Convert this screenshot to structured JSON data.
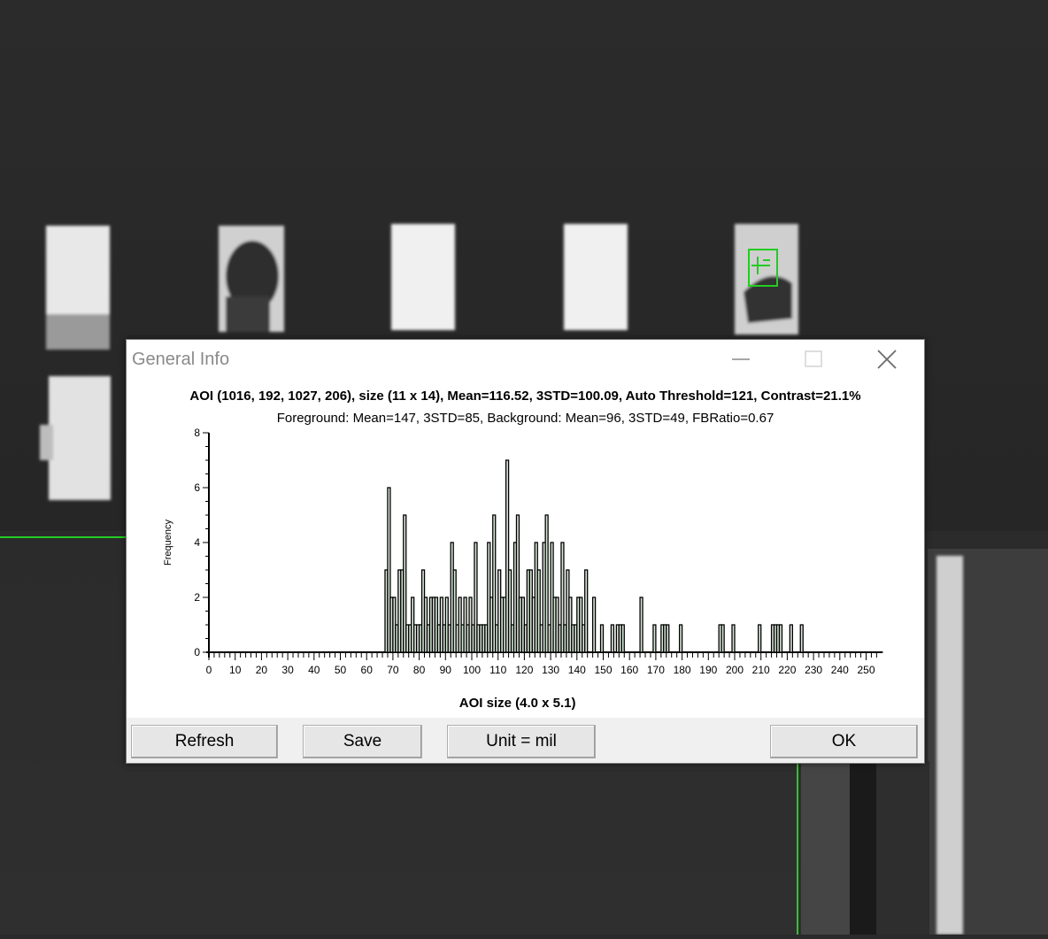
{
  "window": {
    "title": "General Info"
  },
  "info": {
    "line1": "AOI (1016, 192, 1027, 206), size (11 x 14), Mean=116.52, 3STD=100.09, Auto Threshold=121, Contrast=21.1%",
    "line2": "Foreground: Mean=147, 3STD=85, Background: Mean=96, 3STD=49, FBRatio=0.67"
  },
  "buttons": {
    "refresh": "Refresh",
    "save": "Save",
    "unit": "Unit = mil",
    "ok": "OK"
  },
  "colors": {
    "overlay_green": "#22cc22",
    "bar_fill": "#d8e6d8",
    "bar_stroke": "#000000"
  },
  "icons": {
    "minimize": "minimize-icon",
    "maximize": "maximize-icon",
    "close": "close-icon"
  },
  "chart_data": {
    "type": "bar",
    "title": "",
    "xlabel": "AOI size (4.0 x 5.1)",
    "ylabel": "Frequency",
    "xlim": [
      0,
      255
    ],
    "ylim": [
      0,
      8
    ],
    "xticks": [
      0,
      10,
      20,
      30,
      40,
      50,
      60,
      70,
      80,
      90,
      100,
      110,
      120,
      130,
      140,
      150,
      160,
      170,
      180,
      190,
      200,
      210,
      220,
      230,
      240,
      250
    ],
    "yticks": [
      0,
      2,
      4,
      6,
      8
    ],
    "x": [
      67,
      68,
      69,
      70,
      71,
      72,
      73,
      74,
      75,
      76,
      77,
      78,
      79,
      80,
      81,
      82,
      83,
      84,
      85,
      86,
      87,
      88,
      89,
      90,
      91,
      92,
      93,
      94,
      95,
      96,
      97,
      98,
      99,
      100,
      101,
      102,
      103,
      104,
      105,
      106,
      107,
      108,
      109,
      110,
      111,
      112,
      113,
      114,
      115,
      116,
      117,
      118,
      119,
      120,
      121,
      122,
      123,
      124,
      125,
      126,
      127,
      128,
      129,
      130,
      131,
      132,
      133,
      134,
      135,
      136,
      137,
      138,
      139,
      140,
      141,
      142,
      143,
      146,
      149,
      153,
      155,
      156,
      157,
      164,
      169,
      172,
      173,
      174,
      179,
      194,
      195,
      199,
      209,
      214,
      215,
      216,
      217,
      221,
      225
    ],
    "values": [
      3,
      6,
      2,
      2,
      1,
      3,
      3,
      5,
      1,
      1,
      2,
      1,
      1,
      1,
      3,
      2,
      1,
      2,
      2,
      2,
      1,
      2,
      1,
      2,
      1,
      4,
      3,
      1,
      2,
      1,
      2,
      1,
      2,
      1,
      4,
      1,
      1,
      1,
      1,
      4,
      2,
      5,
      1,
      3,
      2,
      2,
      7,
      3,
      1,
      4,
      5,
      2,
      2,
      1,
      3,
      3,
      2,
      4,
      3,
      1,
      4,
      5,
      1,
      4,
      2,
      2,
      1,
      4,
      1,
      3,
      2,
      1,
      1,
      2,
      2,
      1,
      3,
      2,
      1,
      1,
      1,
      1,
      1,
      2,
      1,
      1,
      1,
      1,
      1,
      1,
      1,
      1,
      1,
      1,
      1,
      1,
      1,
      1,
      1
    ]
  }
}
